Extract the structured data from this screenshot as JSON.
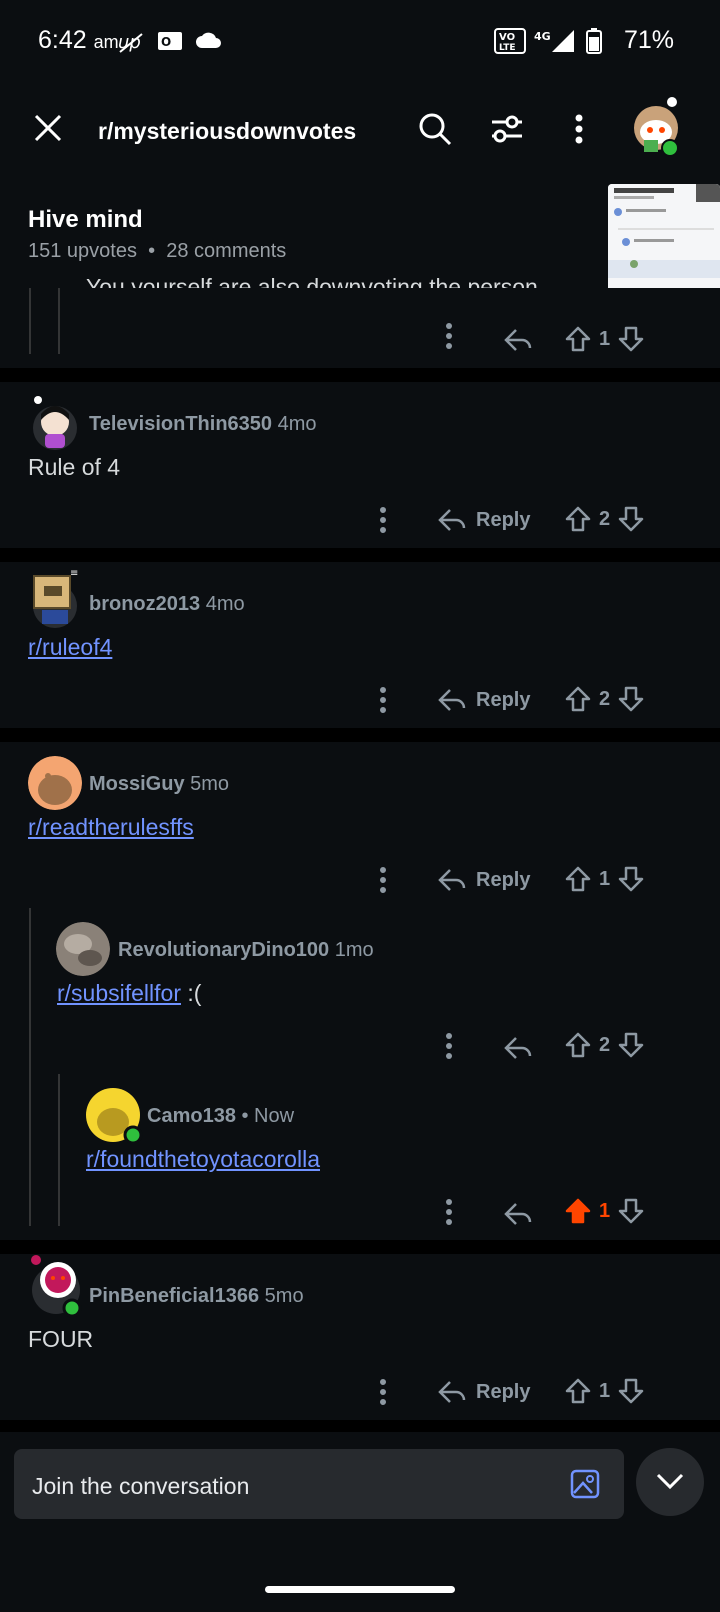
{
  "status_bar": {
    "time": "6:42",
    "ampm": "am",
    "network": "VoLTE 4G",
    "battery": "71%"
  },
  "header": {
    "subreddit": "r/mysteriousdownvotes",
    "icons": [
      "close-icon",
      "search-icon",
      "filter-icon",
      "more-icon",
      "avatar"
    ]
  },
  "post": {
    "title": "Hive mind",
    "upvotes": "151 upvotes",
    "separator": "•",
    "comments": "28 comments",
    "partial_comment": "You yourself are also downvoting the person"
  },
  "comments": [
    {
      "user": "",
      "age": "",
      "body": "",
      "reply": "",
      "votes": "1",
      "upvoted": false
    },
    {
      "user": "TelevisionThin6350",
      "age": "4mo",
      "body": "Rule of 4",
      "reply": "Reply",
      "votes": "2",
      "upvoted": false
    },
    {
      "user": "bronoz2013",
      "age": "4mo",
      "body": "r/ruleof4",
      "reply": "Reply",
      "votes": "2",
      "upvoted": false
    },
    {
      "user": "MossiGuy",
      "age": "5mo",
      "body": "r/readtherulesffs",
      "reply": "Reply",
      "votes": "1",
      "upvoted": false
    },
    {
      "user": "RevolutionaryDino100",
      "age": "1mo",
      "body": "r/subsifellfor",
      "body_suffix": " :(",
      "reply": "",
      "votes": "2",
      "upvoted": false
    },
    {
      "user": "Camo138",
      "age": "• Now",
      "body": "r/foundthetoyotacorolla",
      "reply": "",
      "votes": "1",
      "upvoted": true
    },
    {
      "user": "PinBeneficial1366",
      "age": "5mo",
      "body": "FOUR",
      "reply": "Reply",
      "votes": "1",
      "upvoted": false
    }
  ],
  "composer": {
    "placeholder": "Join the conversation"
  },
  "colors": {
    "background": "#0b0e11",
    "link": "#7193ff",
    "upvote": "#ff4500",
    "online": "#2fbf3d"
  }
}
